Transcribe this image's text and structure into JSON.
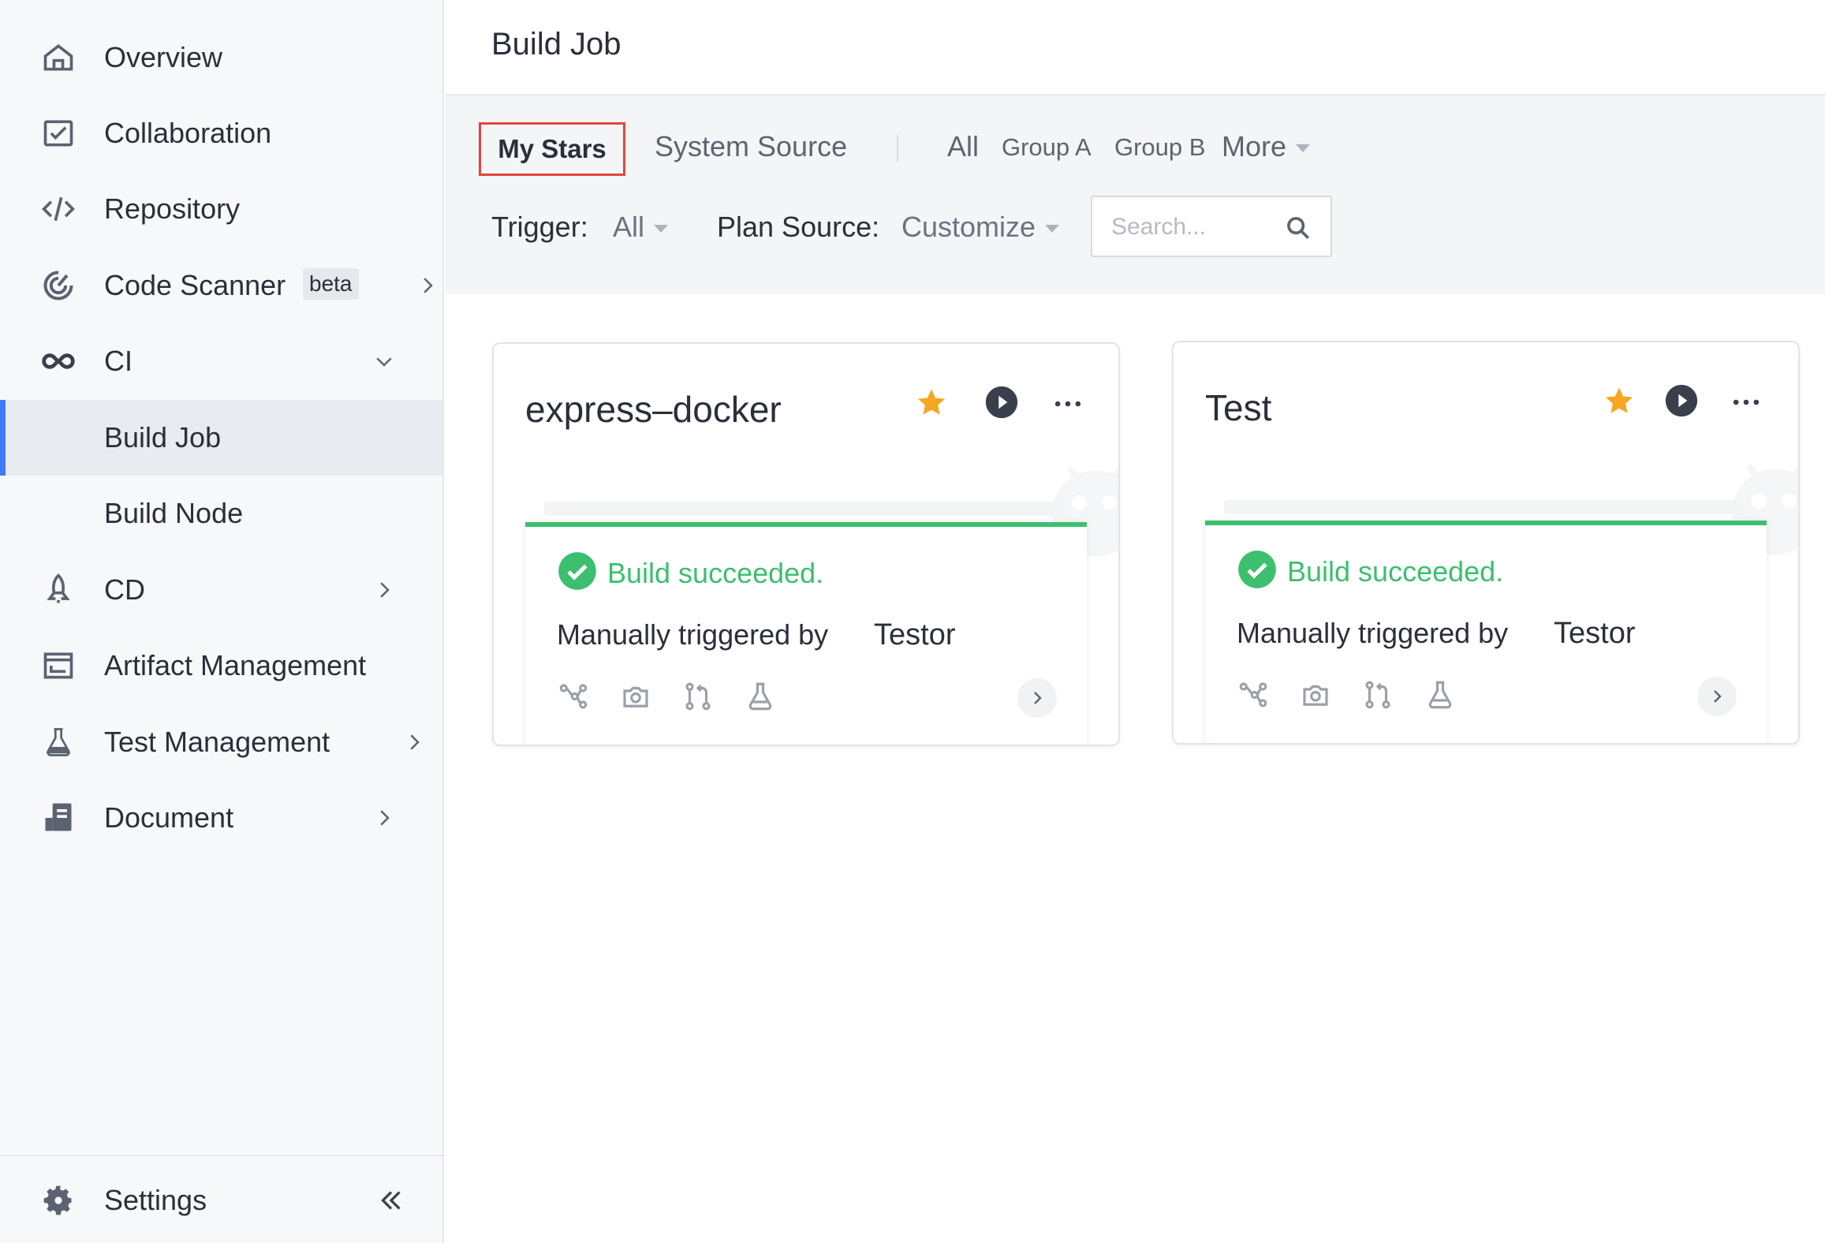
{
  "sidebar": {
    "items": [
      {
        "label": "Overview",
        "icon": "home-icon"
      },
      {
        "label": "Collaboration",
        "icon": "collaboration-icon"
      },
      {
        "label": "Repository",
        "icon": "code-icon"
      },
      {
        "label": "Code Scanner",
        "icon": "scanner-icon",
        "badge": "beta"
      },
      {
        "label": "CI",
        "icon": "infinity-icon"
      },
      {
        "label": "Build Job"
      },
      {
        "label": "Build Node"
      },
      {
        "label": "CD",
        "icon": "rocket-icon"
      },
      {
        "label": "Artifact Management",
        "icon": "artifact-icon"
      },
      {
        "label": "Test Management",
        "icon": "flask-icon"
      },
      {
        "label": "Document",
        "icon": "document-icon"
      }
    ],
    "footer": {
      "label": "Settings",
      "icon": "gear-icon"
    }
  },
  "header": {
    "title": "Build Job"
  },
  "filters": {
    "tabs": {
      "my_stars": "My Stars",
      "system_source": "System Source",
      "all": "All",
      "group_a": "Group A",
      "group_b": "Group B",
      "more": "More"
    },
    "trigger_label": "Trigger:",
    "trigger_value": "All",
    "plan_source_label": "Plan Source:",
    "plan_source_value": "Customize",
    "search_placeholder": "Search..."
  },
  "cards": [
    {
      "title": "express–docker",
      "starred": true,
      "status": "Build succeeded.",
      "trigger_label": "Manually triggered by",
      "trigger_user": "Testor"
    },
    {
      "title": "Test",
      "starred": true,
      "status": "Build succeeded.",
      "trigger_label": "Manually triggered by",
      "trigger_user": "Testor"
    }
  ],
  "colors": {
    "accent": "#3d7bf7",
    "success": "#3cbf6e",
    "star": "#f5a623",
    "highlight": "#e0463a"
  }
}
